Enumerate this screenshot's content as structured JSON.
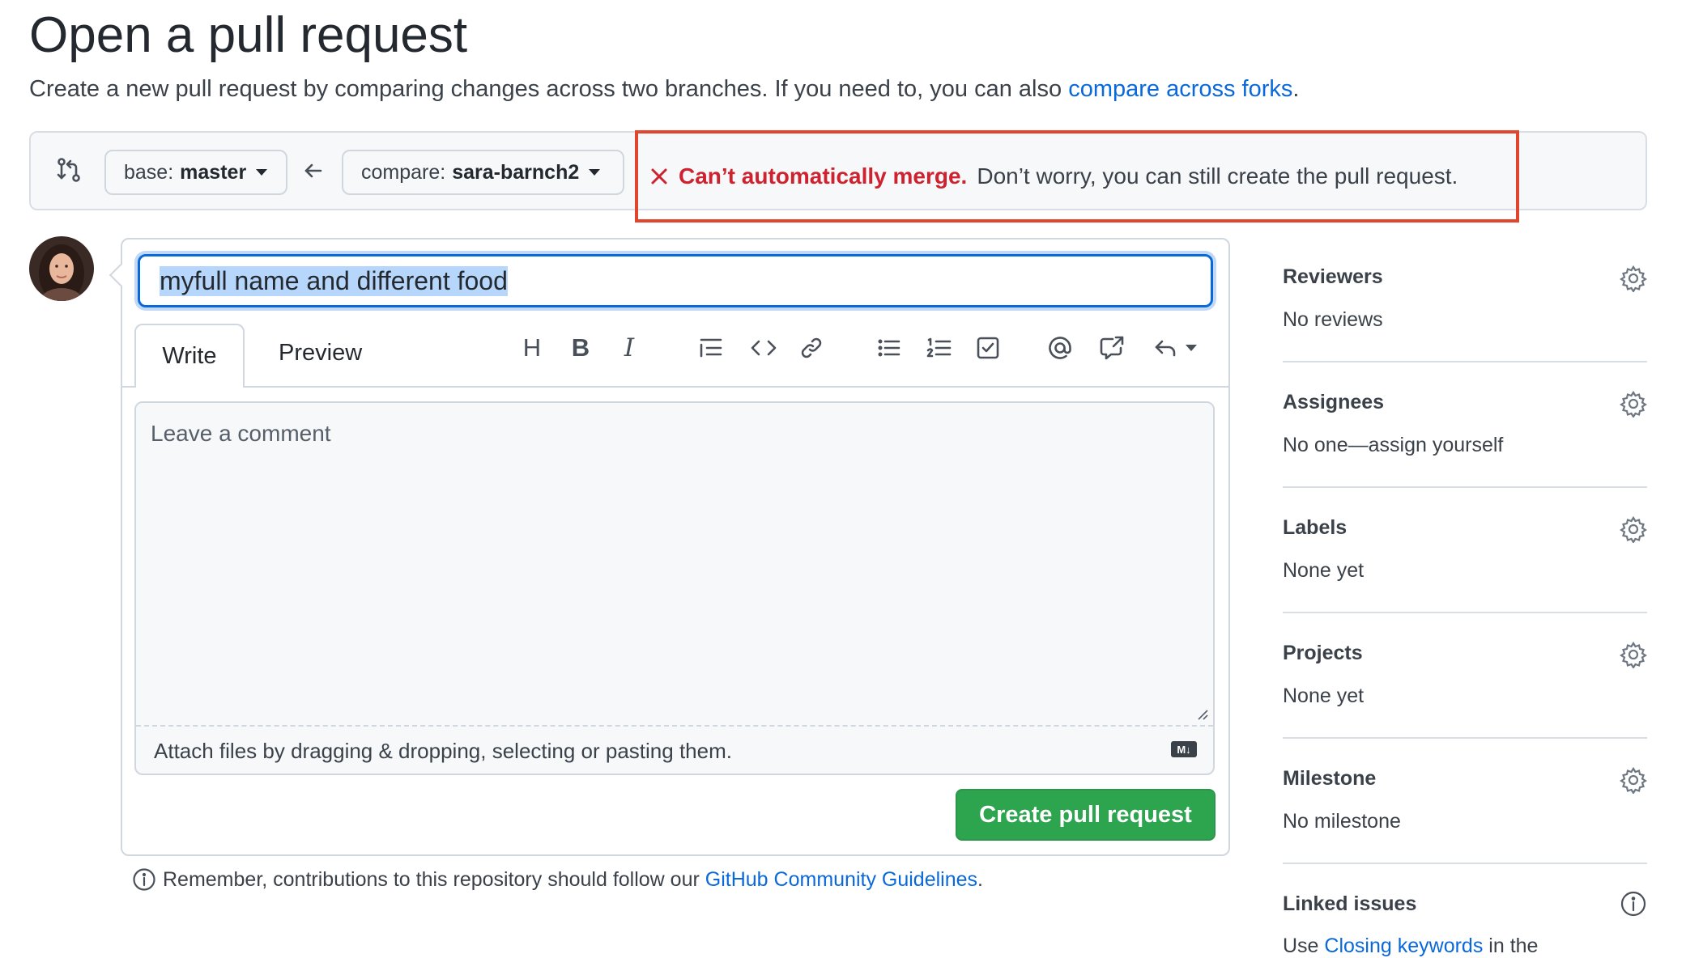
{
  "header": {
    "title": "Open a pull request",
    "subtitle": "Create a new pull request by comparing changes across two branches. If you need to, you can also",
    "subtitle_link": "compare across forks",
    "subtitle_end": "."
  },
  "compare": {
    "base_label": "base:",
    "base_value": "master",
    "compare_label": "compare:",
    "compare_value": "sara-barnch2",
    "merge_status_strong": "Can’t automatically merge.",
    "merge_status_text": "Don’t worry, you can still create the pull request."
  },
  "form": {
    "title_value": "myfull name and different food",
    "tabs": [
      "Write",
      "Preview"
    ],
    "toolbar": {
      "heading": "H",
      "bold": "B",
      "italic": "I"
    },
    "comment_placeholder": "Leave a comment",
    "attach_text": "Attach files by dragging & dropping, selecting or pasting them.",
    "markdown_badge": "M↓",
    "submit_label": "Create pull request"
  },
  "guidelines": {
    "text": "Remember, contributions to this repository should follow our",
    "link": "GitHub Community Guidelines",
    "end": "."
  },
  "sidebar": {
    "reviewers": {
      "title": "Reviewers",
      "value": "No reviews"
    },
    "assignees": {
      "title": "Assignees",
      "value": "No one—assign yourself"
    },
    "labels": {
      "title": "Labels",
      "value": "None yet"
    },
    "projects": {
      "title": "Projects",
      "value": "None yet"
    },
    "milestone": {
      "title": "Milestone",
      "value": "No milestone"
    },
    "linked_issues": {
      "title": "Linked issues",
      "value_prefix": "Use",
      "value_link": "Closing keywords",
      "value_suffix": "in the"
    }
  },
  "colors": {
    "accent": "#0969da",
    "error": "#cf222e",
    "highlight_box": "#e0452e",
    "primary_button": "#2da44e"
  }
}
